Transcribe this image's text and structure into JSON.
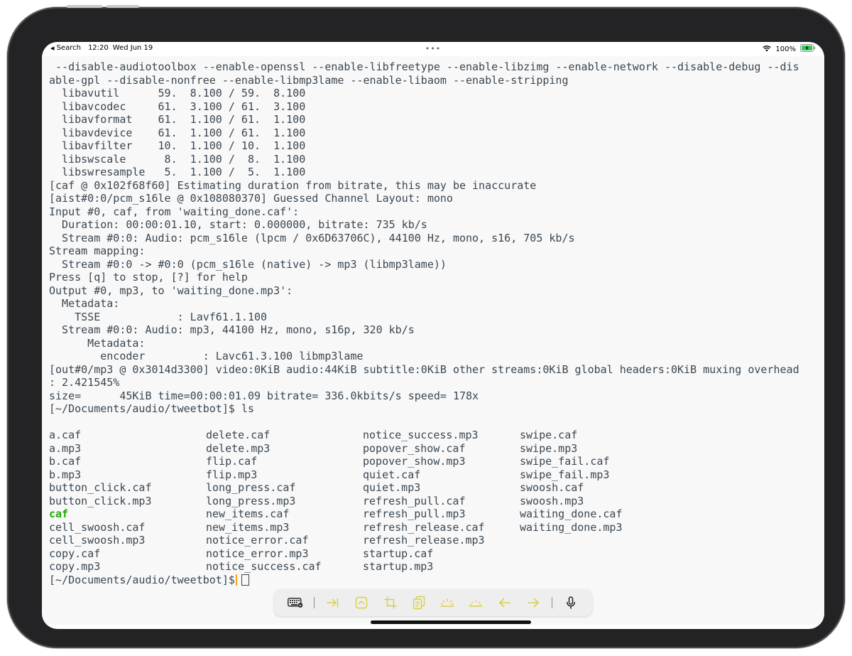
{
  "status_bar": {
    "back_arrow": "◀",
    "back_label": "Search",
    "time": "12:20",
    "date": "Wed Jun 19",
    "dots": "•••",
    "battery_percent": "100%"
  },
  "terminal": {
    "output_lines": [
      " --disable-audiotoolbox --enable-openssl --enable-libfreetype --enable-libzimg --enable-network --disable-debug --dis",
      "able-gpl --disable-nonfree --enable-libmp3lame --enable-libaom --enable-stripping",
      "  libavutil      59.  8.100 / 59.  8.100",
      "  libavcodec     61.  3.100 / 61.  3.100",
      "  libavformat    61.  1.100 / 61.  1.100",
      "  libavdevice    61.  1.100 / 61.  1.100",
      "  libavfilter    10.  1.100 / 10.  1.100",
      "  libswscale      8.  1.100 /  8.  1.100",
      "  libswresample   5.  1.100 /  5.  1.100",
      "[caf @ 0x102f68f60] Estimating duration from bitrate, this may be inaccurate",
      "[aist#0:0/pcm_s16le @ 0x108080370] Guessed Channel Layout: mono",
      "Input #0, caf, from 'waiting_done.caf':",
      "  Duration: 00:00:01.10, start: 0.000000, bitrate: 735 kb/s",
      "  Stream #0:0: Audio: pcm_s16le (lpcm / 0x6D63706C), 44100 Hz, mono, s16, 705 kb/s",
      "Stream mapping:",
      "  Stream #0:0 -> #0:0 (pcm_s16le (native) -> mp3 (libmp3lame))",
      "Press [q] to stop, [?] for help",
      "Output #0, mp3, to 'waiting_done.mp3':",
      "  Metadata:",
      "    TSSE            : Lavf61.1.100",
      "  Stream #0:0: Audio: mp3, 44100 Hz, mono, s16p, 320 kb/s",
      "      Metadata:",
      "        encoder         : Lavc61.3.100 libmp3lame",
      "[out#0/mp3 @ 0x3014d3300] video:0KiB audio:44KiB subtitle:0KiB other streams:0KiB global headers:0KiB muxing overhead",
      ": 2.421545%",
      "size=      45KiB time=00:00:01.09 bitrate= 336.0kbits/s speed= 178x",
      "[~/Documents/audio/tweetbot]$ ls"
    ],
    "ls_columns": [
      [
        "a.caf",
        "a.mp3",
        "b.caf",
        "b.mp3",
        "button_click.caf",
        "button_click.mp3",
        "caf",
        "cell_swoosh.caf",
        "cell_swoosh.mp3",
        "copy.caf",
        "copy.mp3"
      ],
      [
        "delete.caf",
        "delete.mp3",
        "flip.caf",
        "flip.mp3",
        "long_press.caf",
        "long_press.mp3",
        "new_items.caf",
        "new_items.mp3",
        "notice_error.caf",
        "notice_error.mp3",
        "notice_success.caf"
      ],
      [
        "notice_success.mp3",
        "popover_show.caf",
        "popover_show.mp3",
        "quiet.caf",
        "quiet.mp3",
        "refresh_pull.caf",
        "refresh_pull.mp3",
        "refresh_release.caf",
        "refresh_release.mp3",
        "startup.caf",
        "startup.mp3"
      ],
      [
        "swipe.caf",
        "swipe.mp3",
        "swipe_fail.caf",
        "swipe_fail.mp3",
        "swoosh.caf",
        "swoosh.mp3",
        "waiting_done.caf",
        "waiting_done.mp3"
      ]
    ],
    "directory_entries": [
      "caf"
    ],
    "prompt": "[~/Documents/audio/tweetbot]$"
  },
  "toolbar": {
    "icons": [
      "keyboard-icon",
      "tab-icon",
      "control-key-icon",
      "crop-icon",
      "paste-icon",
      "brightness-up-icon",
      "brightness-down-icon",
      "arrow-left-icon",
      "arrow-right-icon",
      "microphone-icon"
    ]
  },
  "colors": {
    "terminal_bg": "#f8f8f8",
    "terminal_text": "#3a4752",
    "directory_text": "#1faa00",
    "caret": "#f4a21a",
    "toolbar_icon": "#d9cf4c",
    "battery": "#34c759"
  }
}
